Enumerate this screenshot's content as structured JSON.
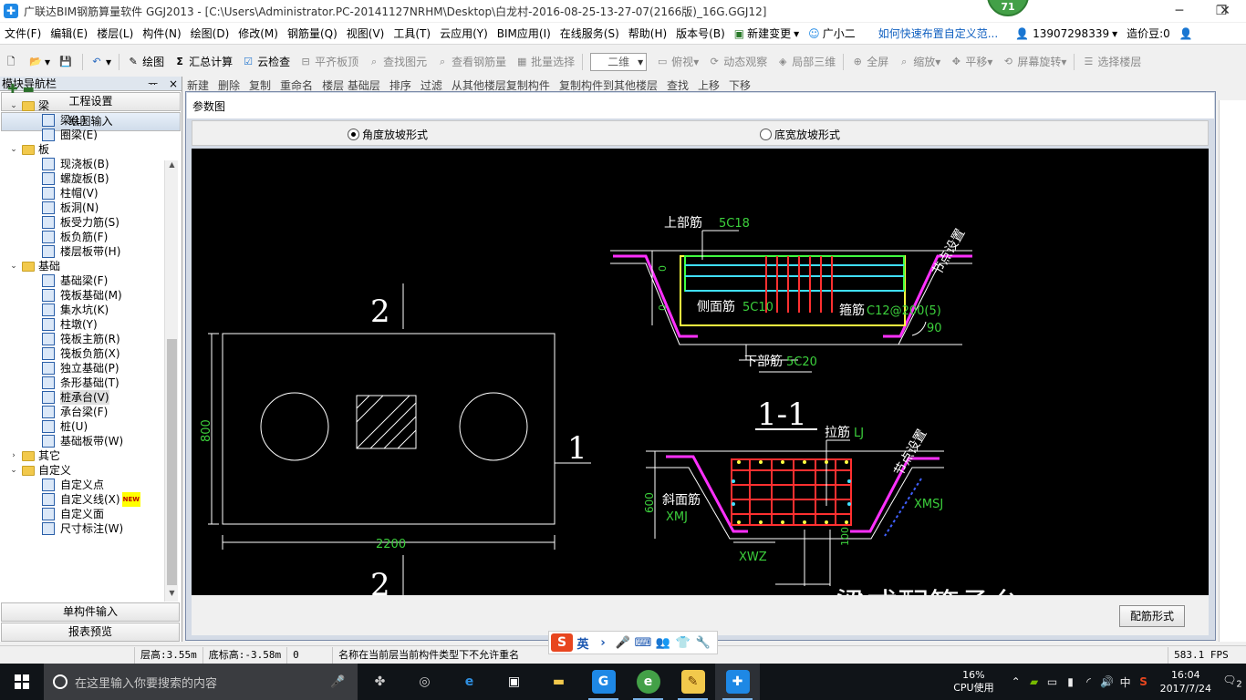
{
  "titlebar": {
    "title": "广联达BIM钢筋算量软件 GGJ2013 - [C:\\Users\\Administrator.PC-20141127NRHM\\Desktop\\白龙村-2016-08-25-13-27-07(2166版)_16G.GGJ12]",
    "badge": "71",
    "minimize": "─",
    "restore": "❐",
    "close": "✕"
  },
  "menubar": {
    "items": [
      "文件(F)",
      "编辑(E)",
      "楼层(L)",
      "构件(N)",
      "绘图(D)",
      "修改(M)",
      "钢筋量(Q)",
      "视图(V)",
      "工具(T)",
      "云应用(Y)",
      "BIM应用(I)",
      "在线服务(S)",
      "帮助(H)",
      "版本号(B)"
    ],
    "new_change": "新建变更",
    "assistant": "广小二",
    "help_link": "如何快速布置自定义范...",
    "phone": "13907298339",
    "coins": "造价豆:0"
  },
  "toolbar1": {
    "draw": "绘图",
    "sum": "汇总计算",
    "cloud_check": "云检查",
    "align_top": "平齐板顶",
    "find_element": "查找图元",
    "view_rebar": "查看钢筋量",
    "batch_select": "批量选择",
    "view_mode": "二维",
    "top_view": "俯视",
    "dynamic_observe": "动态观察",
    "local_3d": "局部三维",
    "fullscreen": "全屏",
    "zoom": "缩放",
    "pan": "平移",
    "rotate": "屏幕旋转",
    "select_floor": "选择楼层"
  },
  "toolbar2": {
    "items": [
      "新建",
      "删除",
      "复制",
      "重命名",
      "楼层 基础层",
      "排序",
      "过滤",
      "从其他楼层复制构件",
      "复制构件到其他楼层",
      "查找",
      "上移",
      "下移"
    ]
  },
  "nav": {
    "header": "模块导航栏",
    "pin": "ᅲ",
    "close": "×",
    "project_settings": "工程设置",
    "draw_input": "绘图输入",
    "tree_tools": "+ −",
    "tree": [
      {
        "type": "folder",
        "label": "梁",
        "expanded": true
      },
      {
        "type": "leaf",
        "label": "梁(L)",
        "icon": "beam-icon"
      },
      {
        "type": "leaf",
        "label": "圈梁(E)",
        "icon": "ring-beam-icon"
      },
      {
        "type": "folder",
        "label": "板",
        "expanded": true
      },
      {
        "type": "leaf",
        "label": "现浇板(B)",
        "icon": "slab-icon"
      },
      {
        "type": "leaf",
        "label": "螺旋板(B)",
        "icon": "spiral-slab-icon"
      },
      {
        "type": "leaf",
        "label": "柱帽(V)",
        "icon": "column-cap-icon"
      },
      {
        "type": "leaf",
        "label": "板洞(N)",
        "icon": "slab-hole-icon"
      },
      {
        "type": "leaf",
        "label": "板受力筋(S)",
        "icon": "slab-rebar-icon"
      },
      {
        "type": "leaf",
        "label": "板负筋(F)",
        "icon": "slab-neg-rebar-icon"
      },
      {
        "type": "leaf",
        "label": "楼层板带(H)",
        "icon": "slab-strip-icon"
      },
      {
        "type": "folder",
        "label": "基础",
        "expanded": true
      },
      {
        "type": "leaf",
        "label": "基础梁(F)",
        "icon": "foundation-beam-icon"
      },
      {
        "type": "leaf",
        "label": "筏板基础(M)",
        "icon": "raft-icon"
      },
      {
        "type": "leaf",
        "label": "集水坑(K)",
        "icon": "sump-icon"
      },
      {
        "type": "leaf",
        "label": "柱墩(Y)",
        "icon": "pier-icon"
      },
      {
        "type": "leaf",
        "label": "筏板主筋(R)",
        "icon": "raft-main-rebar-icon"
      },
      {
        "type": "leaf",
        "label": "筏板负筋(X)",
        "icon": "raft-neg-rebar-icon"
      },
      {
        "type": "leaf",
        "label": "独立基础(P)",
        "icon": "isolated-footing-icon"
      },
      {
        "type": "leaf",
        "label": "条形基础(T)",
        "icon": "strip-footing-icon"
      },
      {
        "type": "leaf",
        "label": "桩承台(V)",
        "icon": "pile-cap-icon",
        "selected": true
      },
      {
        "type": "leaf",
        "label": "承台梁(F)",
        "icon": "cap-beam-icon"
      },
      {
        "type": "leaf",
        "label": "桩(U)",
        "icon": "pile-icon"
      },
      {
        "type": "leaf",
        "label": "基础板带(W)",
        "icon": "foundation-strip-icon"
      },
      {
        "type": "folder",
        "label": "其它",
        "expanded": false
      },
      {
        "type": "folder",
        "label": "自定义",
        "expanded": true
      },
      {
        "type": "leaf",
        "label": "自定义点",
        "icon": "custom-point-icon"
      },
      {
        "type": "leaf",
        "label": "自定义线(X)",
        "icon": "custom-line-icon",
        "new": "NEW"
      },
      {
        "type": "leaf",
        "label": "自定义面",
        "icon": "custom-face-icon"
      },
      {
        "type": "leaf",
        "label": "尺寸标注(W)",
        "icon": "dimension-icon"
      }
    ],
    "single_input": "单构件输入",
    "report_preview": "报表预览"
  },
  "dialog": {
    "title": "参数图",
    "radio_angle": "角度放坡形式",
    "radio_width": "底宽放坡形式",
    "rebar_form_btn": "配筋形式",
    "drawing": {
      "section_top": "2",
      "section_bottom": "2",
      "section_right": "1",
      "dim_height": "800",
      "dim_width": "2200",
      "top_rebar_label": "上部筋",
      "top_rebar_value": "5C18",
      "side_rebar_label": "侧面筋",
      "side_rebar_value": "5C10",
      "stirrup_label": "箍筋",
      "stirrup_value": "C12@200(5)",
      "bottom_rebar_label": "下部筋",
      "bottom_rebar_value": "5C20",
      "node_setting_1": "节点设置",
      "angle": "90",
      "section_title": "1-1",
      "tie_label": "拉筋",
      "tie_value": "LJ",
      "node_setting_2": "节点设置",
      "slope_label": "斜面筋",
      "slope_value": "XMJ",
      "xmsj": "XMSJ",
      "xwz": "XWZ",
      "dim_600": "600",
      "dim_100": "100",
      "dim_0a": "0",
      "dim_0b": "0",
      "cut_text": "梁式配筋承台"
    }
  },
  "statusbar": {
    "floor_height": "层高:3.55m",
    "bottom_elev": "底标高:-3.58m",
    "zero": "0",
    "message": "名称在当前层当前构件类型下不允许重名",
    "fps": "583.1 FPS"
  },
  "ime": {
    "logo": "S",
    "items": [
      "英",
      "›",
      "🎤",
      "⌨",
      "👥",
      "👕",
      "🔧"
    ]
  },
  "taskbar": {
    "search_placeholder": "在这里输入你要搜索的内容",
    "cpu_percent": "16%",
    "cpu_label": "CPU使用",
    "ime_lang": "中",
    "time": "16:04",
    "date": "2017/7/24",
    "notifications": "2"
  }
}
